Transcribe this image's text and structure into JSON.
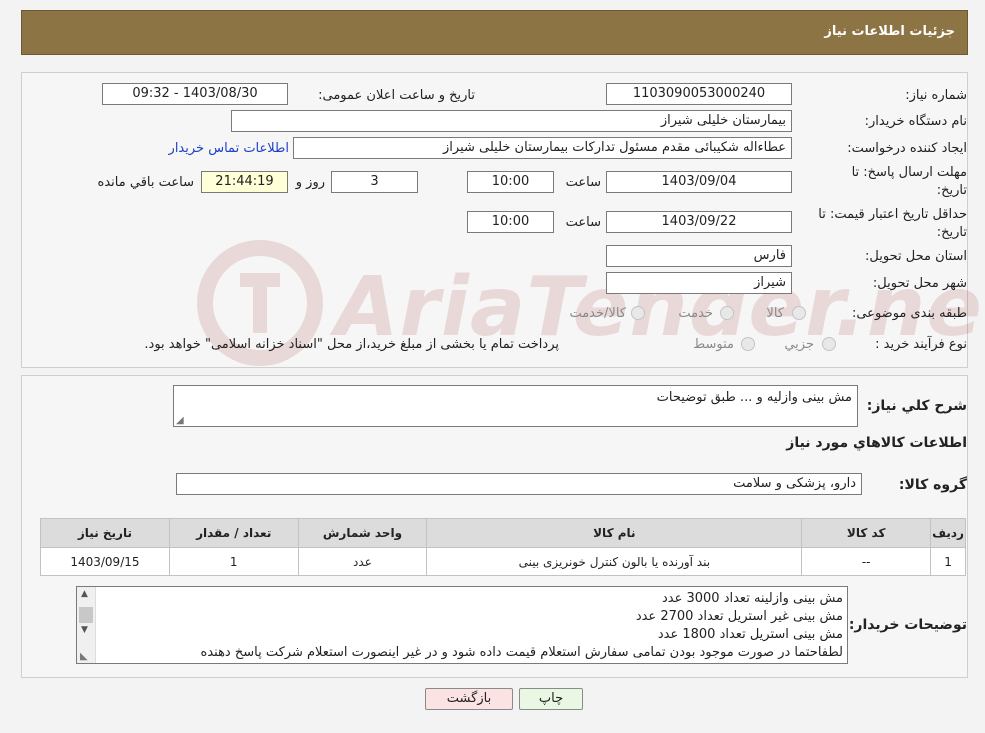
{
  "header": {
    "title": "جزئیات اطلاعات نیاز"
  },
  "fields": {
    "need_number_label": "شماره نیاز:",
    "need_number": "1103090053000240",
    "announce_label": "تاریخ و ساعت اعلان عمومی:",
    "announce_value": "1403/08/30 - 09:32",
    "buyer_org_label": "نام دستگاه خریدار:",
    "buyer_org": "بیمارستان خلیلی شیراز",
    "creator_label": "ایجاد کننده درخواست:",
    "creator": "عطاءاله شکیبائی مقدم مسئول تدارکات  بیمارستان خلیلی شیراز",
    "contact_link": "اطلاعات تماس خریدار",
    "deadline_label_1": "مهلت ارسال پاسخ: تا",
    "deadline_label_2": "تاریخ:",
    "deadline_date": "1403/09/04",
    "time_label": "ساعت",
    "deadline_time": "10:00",
    "days_value": "3",
    "days_label": "روز و",
    "remaining_time": "21:44:19",
    "remaining_label": "ساعت باقي مانده",
    "validity_label_1": "حداقل تاریخ اعتبار قیمت: تا",
    "validity_label_2": "تاریخ:",
    "validity_date": "1403/09/22",
    "validity_time_label": "ساعت",
    "validity_time": "10:00",
    "province_label": "استان محل تحویل:",
    "province": "فارس",
    "city_label": "شهر محل تحویل:",
    "city": "شیراز",
    "category_label": "طبقه بندی موضوعی:",
    "category_options": [
      "کالا",
      "خدمت",
      "کالا/خدمت"
    ],
    "purchase_type_label": "نوع فرآیند خرید :",
    "purchase_options": [
      "جزیي",
      "متوسط"
    ],
    "purchase_note": "پرداخت تمام یا بخشی از مبلغ خرید،از محل \"اسناد خزانه اسلامی\" خواهد بود."
  },
  "summary": {
    "description_label": "شرح کلي نياز:",
    "description": "مش بینی وازلیه و ... طبق توضیحات",
    "goods_info_title": "اطلاعات کالاهاي مورد نياز",
    "goods_group_label": "گروه کالا:",
    "goods_group": "دارو، پزشکی و سلامت"
  },
  "table": {
    "headers": [
      "رديف",
      "کد کالا",
      "نام کالا",
      "واحد شمارش",
      "تعداد / مقدار",
      "تاریخ نیاز"
    ],
    "rows": [
      [
        "1",
        "--",
        "بند آورنده یا بالون کنترل خونریزی بینی",
        "عدد",
        "1",
        "1403/09/15"
      ]
    ]
  },
  "buyer_notes": {
    "label": "توضیحات خریدار:",
    "lines": [
      "مش بینی وازلینه تعداد 3000 عدد",
      "مش بینی غیر استریل تعداد 2700 عدد",
      "مش بینی استریل تعداد 1800 عدد",
      "لطفاحتما در صورت موجود بودن تمامی سفارش استعلام قیمت داده شود و در غیر اینصورت استعلام شرکت پاسخ دهنده"
    ]
  },
  "buttons": {
    "print": "چاپ",
    "back": "بازگشت"
  },
  "watermark": {
    "text": "AriaTender.neT"
  },
  "colors": {
    "header_bg": "#8d7445",
    "link": "#1d3fcc",
    "print_bg": "#e9f7e3",
    "back_bg": "#fbe3e3"
  }
}
